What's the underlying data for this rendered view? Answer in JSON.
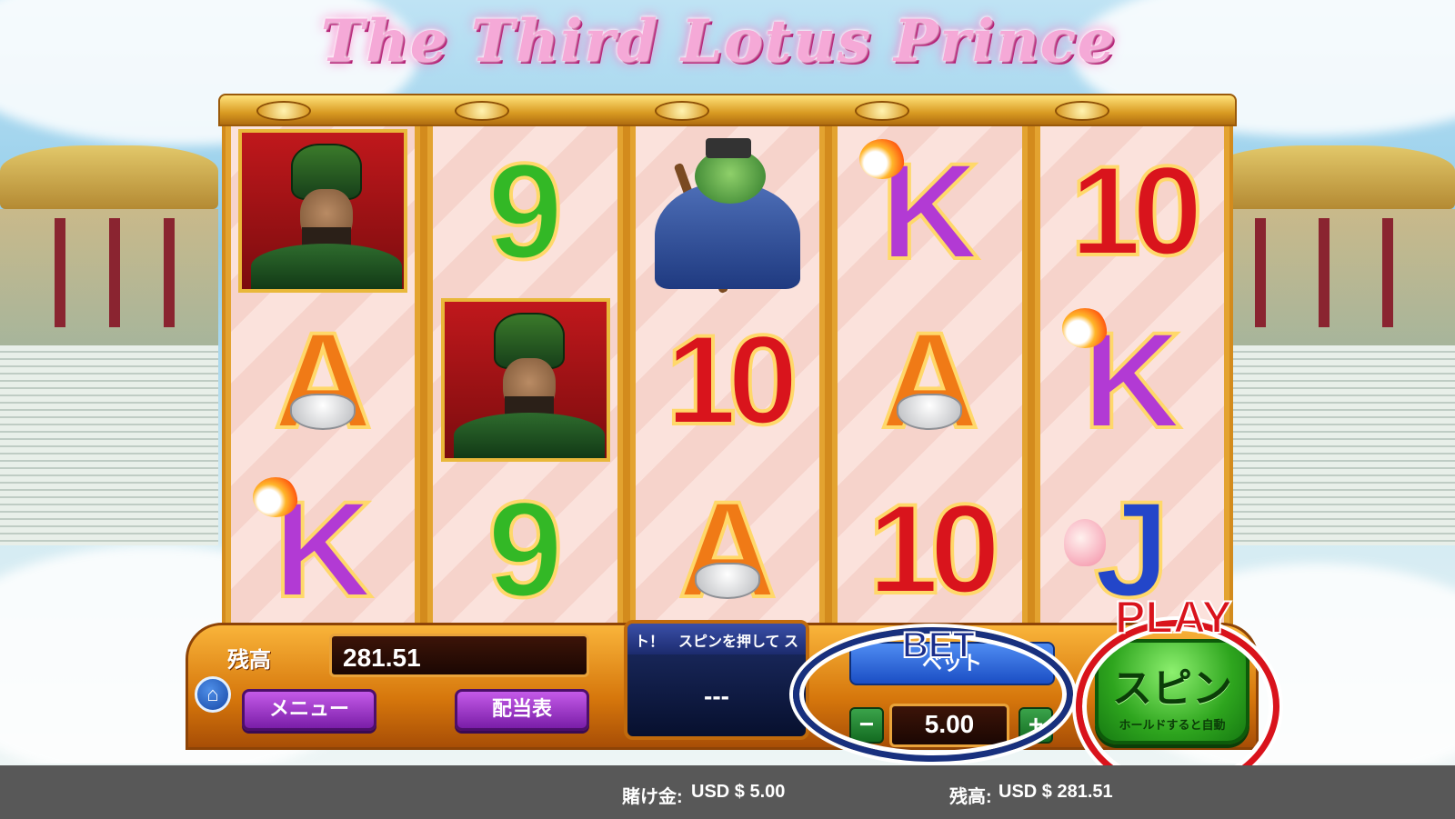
{
  "game": {
    "title": "The Third Lotus Prince"
  },
  "reels": [
    [
      "warrior",
      "A",
      "K"
    ],
    [
      "9",
      "warrior",
      "9"
    ],
    [
      "frog",
      "10",
      "A"
    ],
    [
      "K",
      "A",
      "10"
    ],
    [
      "10",
      "K",
      "J"
    ]
  ],
  "console": {
    "balance_label": "残高",
    "balance_value": "281.51",
    "menu_label": "メニュー",
    "paytable_label": "配当表",
    "message_ticker": "ト！　スピンを押して ス",
    "message_main": "---",
    "bet_label": "ベット",
    "bet_value": "5.00",
    "minus_label": "−",
    "plus_label": "+",
    "spin_label": "スピン",
    "spin_sublabel": "ホールドすると自動"
  },
  "annotations": {
    "bet_label": "BET",
    "play_label": "PLAY",
    "bet_ring_color": "#18307e",
    "play_ring_color": "#d9131c"
  },
  "footer": {
    "bet_label": "賭け金:",
    "bet_value": "USD $ 5.00",
    "balance_label": "残高:",
    "balance_value": "USD $ 281.51"
  },
  "icons": {
    "home": "home-icon"
  }
}
